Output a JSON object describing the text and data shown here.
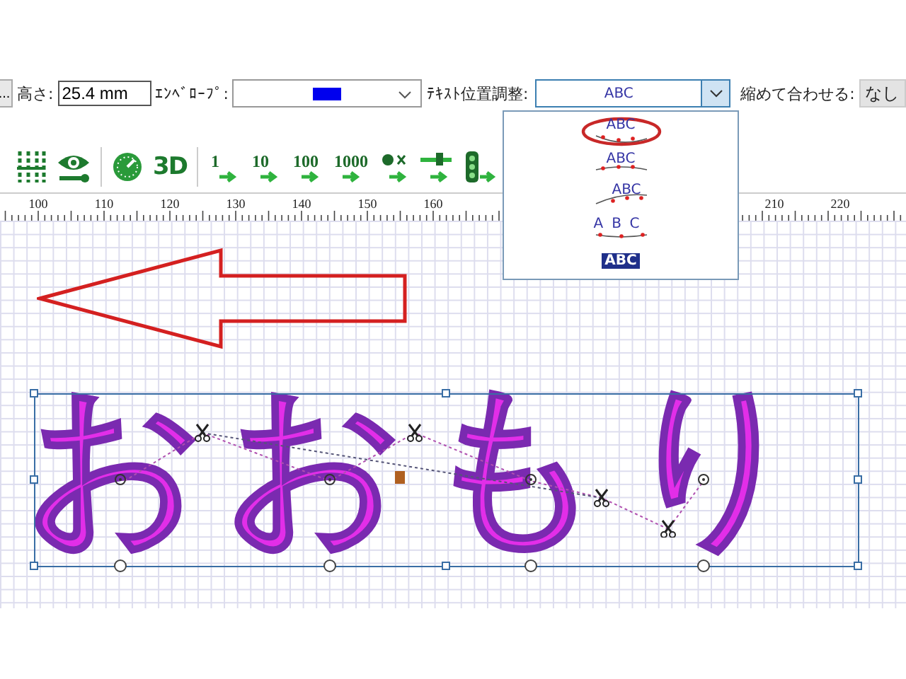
{
  "properties_bar": {
    "more_button": "...",
    "height_label": "高さ:",
    "height_value": "25.4 mm",
    "envelope_label": "ｴﾝﾍﾞﾛｰﾌﾟ:",
    "text_position_label": "ﾃｷｽﾄ位置調整:",
    "text_position_value": "ABC",
    "fit_label": "縮めて合わせる:",
    "fit_value": "なし"
  },
  "text_position_options": [
    {
      "label": "ABC",
      "kind": "top",
      "selected": true
    },
    {
      "label": "ABC",
      "kind": "middle",
      "selected": false
    },
    {
      "label": "ABC",
      "kind": "bottom",
      "selected": false
    },
    {
      "label": "ABC",
      "kind": "spread",
      "selected": false
    },
    {
      "label": "ABC",
      "kind": "boxed",
      "selected": false
    }
  ],
  "tools": [
    {
      "kind": "stitch-grid"
    },
    {
      "kind": "eye"
    },
    {
      "kind": "separator"
    },
    {
      "kind": "gauge"
    },
    {
      "kind": "badge",
      "label": "3D"
    },
    {
      "kind": "separator"
    },
    {
      "kind": "step",
      "label": "1"
    },
    {
      "kind": "step",
      "label": "10"
    },
    {
      "kind": "step",
      "label": "100"
    },
    {
      "kind": "step",
      "label": "1000"
    },
    {
      "kind": "dot-cross"
    },
    {
      "kind": "needle"
    },
    {
      "kind": "lights"
    }
  ],
  "ruler": {
    "left_labels": [
      "100",
      "110",
      "120",
      "130",
      "140",
      "150",
      "160"
    ],
    "right_labels": [
      "210",
      "220"
    ]
  },
  "design": {
    "text": "おおもり"
  }
}
